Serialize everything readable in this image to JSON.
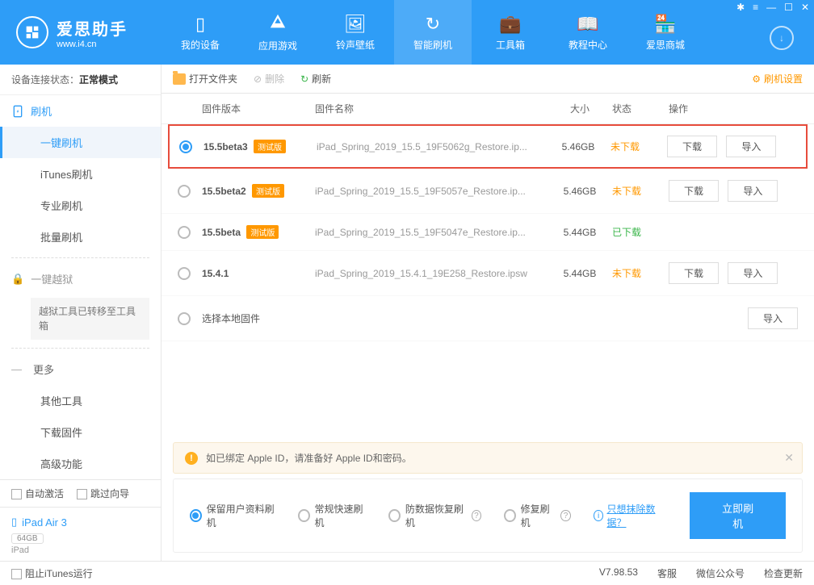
{
  "app": {
    "name": "爱思助手",
    "url": "www.i4.cn"
  },
  "nav": [
    {
      "label": "我的设备",
      "icon_name": "device-icon"
    },
    {
      "label": "应用游戏",
      "icon_name": "apps-icon"
    },
    {
      "label": "铃声壁纸",
      "icon_name": "ringtone-icon"
    },
    {
      "label": "智能刷机",
      "icon_name": "flash-icon"
    },
    {
      "label": "工具箱",
      "icon_name": "toolbox-icon"
    },
    {
      "label": "教程中心",
      "icon_name": "tutorial-icon"
    },
    {
      "label": "爱思商城",
      "icon_name": "shop-icon"
    }
  ],
  "connection": {
    "label": "设备连接状态：",
    "status": "正常模式"
  },
  "toolbar": {
    "open_folder": "打开文件夹",
    "delete": "删除",
    "refresh": "刷新",
    "settings": "刷机设置"
  },
  "sidebar": {
    "flash_group": "刷机",
    "items": {
      "one_click": "一键刷机",
      "itunes": "iTunes刷机",
      "pro": "专业刷机",
      "batch": "批量刷机"
    },
    "jailbreak": "一键越狱",
    "jailbreak_note": "越狱工具已转移至工具箱",
    "more": "更多",
    "other_tools": "其他工具",
    "download_fw": "下载固件",
    "advanced": "高级功能",
    "auto_activate": "自动激活",
    "skip_guide": "跳过向导"
  },
  "device": {
    "name": "iPad Air 3",
    "capacity": "64GB",
    "type": "iPad"
  },
  "table": {
    "headers": {
      "version": "固件版本",
      "name": "固件名称",
      "size": "大小",
      "status": "状态",
      "action": "操作"
    },
    "btn_download": "下载",
    "btn_import": "导入",
    "select_local": "选择本地固件",
    "beta_tag": "测试版",
    "rows": [
      {
        "version": "15.5beta3",
        "beta": true,
        "name": "iPad_Spring_2019_15.5_19F5062g_Restore.ip...",
        "size": "5.46GB",
        "status": "未下载",
        "status_type": "not"
      },
      {
        "version": "15.5beta2",
        "beta": true,
        "name": "iPad_Spring_2019_15.5_19F5057e_Restore.ip...",
        "size": "5.46GB",
        "status": "未下载",
        "status_type": "not"
      },
      {
        "version": "15.5beta",
        "beta": true,
        "name": "iPad_Spring_2019_15.5_19F5047e_Restore.ip...",
        "size": "5.44GB",
        "status": "已下载",
        "status_type": "done"
      },
      {
        "version": "15.4.1",
        "beta": false,
        "name": "iPad_Spring_2019_15.4.1_19E258_Restore.ipsw",
        "size": "5.44GB",
        "status": "未下载",
        "status_type": "not"
      }
    ]
  },
  "warning": {
    "text": "如已绑定 Apple ID，请准备好 Apple ID和密码。"
  },
  "options": {
    "keep_data": "保留用户资料刷机",
    "normal": "常规快速刷机",
    "anti_recovery": "防数据恢复刷机",
    "repair": "修复刷机",
    "erase_link": "只想抹除数据？",
    "flash_btn": "立即刷机"
  },
  "status_bar": {
    "block_itunes": "阻止iTunes运行",
    "version": "V7.98.53",
    "support": "客服",
    "wechat": "微信公众号",
    "check_update": "检查更新"
  }
}
